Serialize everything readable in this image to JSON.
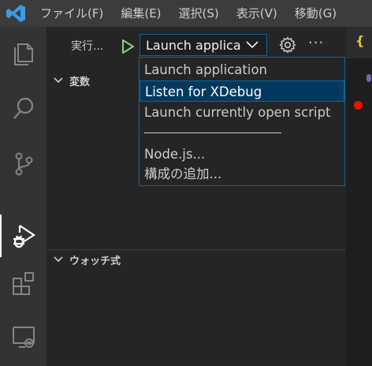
{
  "menubar": {
    "items": [
      "ファイル(F)",
      "編集(E)",
      "選択(S)",
      "表示(V)",
      "移動(G)"
    ]
  },
  "activity_bar": {
    "items": [
      "explorer-icon",
      "search-icon",
      "source-control-icon",
      "run-debug-icon",
      "extensions-icon",
      "remote-explorer-icon"
    ],
    "active": "run-debug-icon"
  },
  "debug_toolbar": {
    "run_label": "実行...",
    "selected_config": "Launch applica"
  },
  "dropdown": {
    "options": [
      "Launch application",
      "Listen for XDebug",
      "Launch currently open script",
      "Node.js...",
      "構成の追加..."
    ],
    "selected_index": 1
  },
  "sections": {
    "variables": "変数",
    "watch": "ウォッチ式"
  },
  "colors": {
    "accent": "#0e639c",
    "selection": "#04395e",
    "breakpoint": "#e51400",
    "start": "#89d185"
  }
}
